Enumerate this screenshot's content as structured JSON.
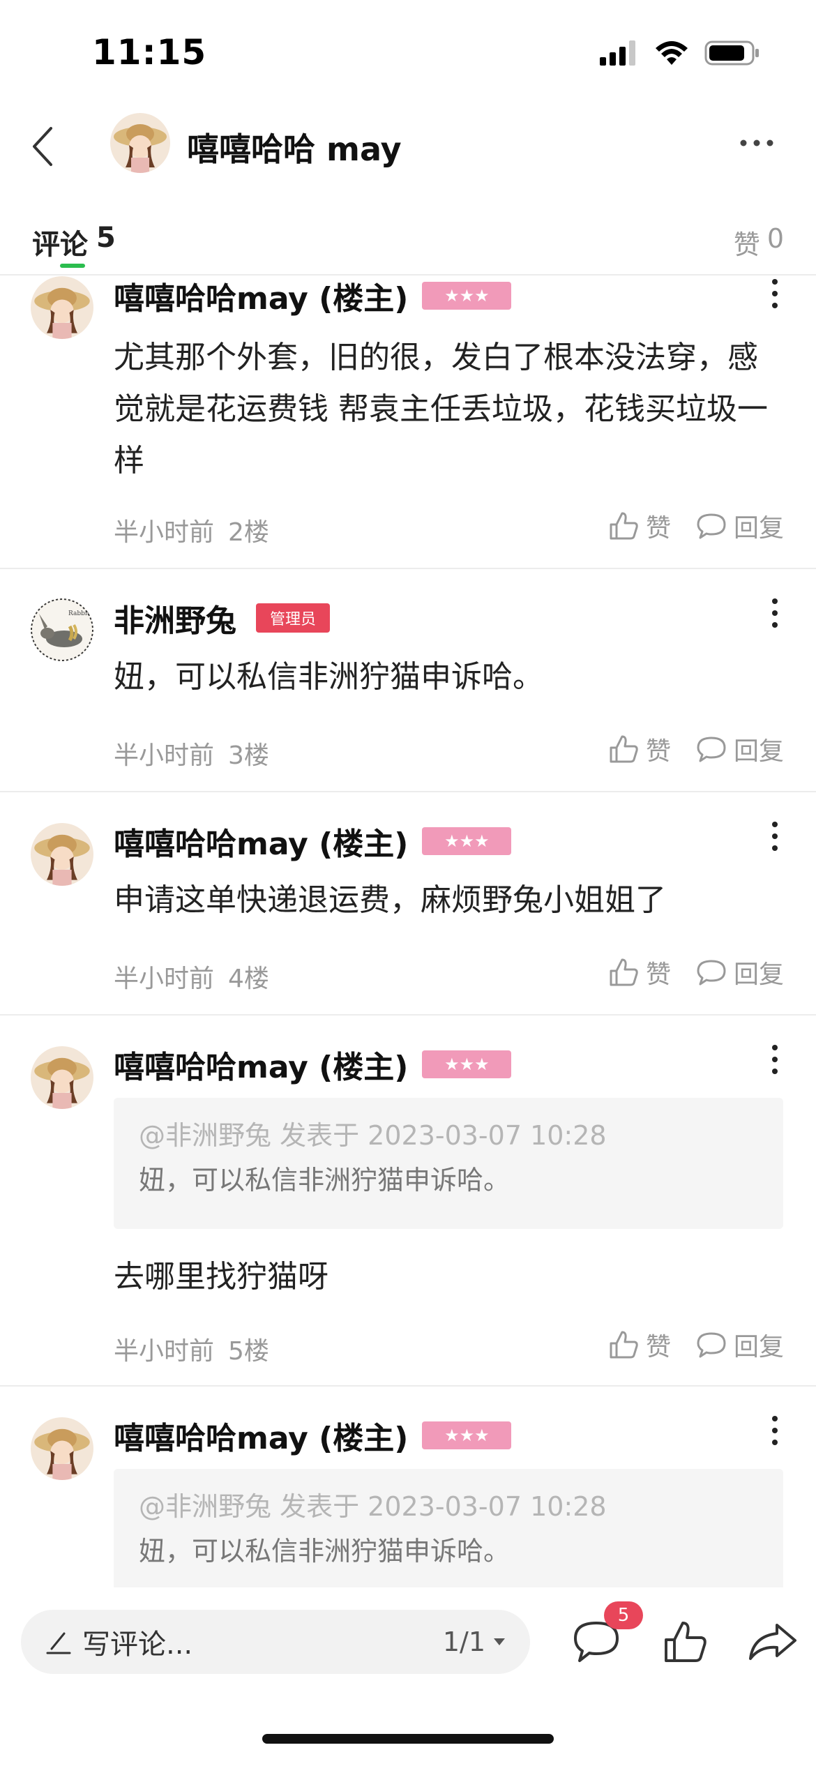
{
  "status_bar": {
    "time": "11:15"
  },
  "header": {
    "title": "嘻嘻哈哈 may"
  },
  "tabs": {
    "comments_label": "评论",
    "comments_count": "5",
    "likes_label": "赞",
    "likes_count": "0"
  },
  "comments": [
    {
      "author": "嘻嘻哈哈may (楼主)",
      "badge": "★★★",
      "text": "尤其那个外套，旧的很，发白了根本没法穿，感觉就是花运费钱 帮袁主任丢垃圾，花钱买垃圾一样",
      "time": "半小时前",
      "floor": "2楼",
      "like_label": "赞",
      "reply_label": "回复"
    },
    {
      "author": "非洲野兔",
      "badge": "管理员",
      "text": "妞，可以私信非洲狞猫申诉哈。",
      "time": "半小时前",
      "floor": "3楼",
      "like_label": "赞",
      "reply_label": "回复"
    },
    {
      "author": "嘻嘻哈哈may (楼主)",
      "badge": "★★★",
      "text": "申请这单快递退运费，麻烦野兔小姐姐了",
      "time": "半小时前",
      "floor": "4楼",
      "like_label": "赞",
      "reply_label": "回复"
    },
    {
      "author": "嘻嘻哈哈may (楼主)",
      "badge": "★★★",
      "quote_meta": "@非洲野兔 发表于 2023-03-07 10:28",
      "quote_text": "妞，可以私信非洲狞猫申诉哈。",
      "text": "去哪里找狞猫呀",
      "time": "半小时前",
      "floor": "5楼",
      "like_label": "赞",
      "reply_label": "回复"
    },
    {
      "author": "嘻嘻哈哈may (楼主)",
      "badge": "★★★",
      "quote_meta": "@非洲野兔 发表于 2023-03-07 10:28",
      "quote_text": "妞，可以私信非洲狞猫申诉哈。"
    }
  ],
  "bottom_bar": {
    "input_placeholder": "写评论...",
    "page_indicator": "1/1",
    "comment_count_badge": "5"
  },
  "icons": {
    "back": "back-chevron-icon",
    "more": "more-dots-icon",
    "like": "thumbs-up-icon",
    "reply": "speech-bubble-icon",
    "pen": "pen-icon",
    "share": "share-arrow-icon"
  },
  "colors": {
    "accent_green": "#2bbd4e",
    "badge_pink": "#f19ab9",
    "admin_red": "#e8465a"
  }
}
